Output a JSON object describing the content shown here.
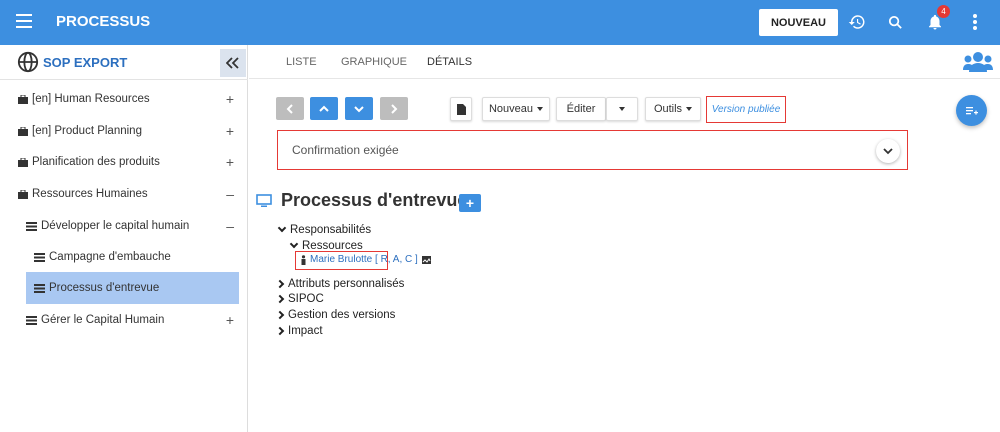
{
  "header": {
    "title": "PROCESSUS",
    "new_button": "NOUVEAU",
    "notification_count": "4",
    "accent_color": "#3d8fe0"
  },
  "sidebar": {
    "title": "SOP EXPORT",
    "items": [
      {
        "label": "[en] Human Resources",
        "toggle": "+"
      },
      {
        "label": "[en] Product Planning",
        "toggle": "+"
      },
      {
        "label": "Planification des produits",
        "toggle": "+"
      },
      {
        "label": "Ressources Humaines",
        "toggle": "–"
      },
      {
        "label": "Développer le capital humain",
        "toggle": "–"
      },
      {
        "label": "Campagne d'embauche",
        "toggle": ""
      },
      {
        "label": "Processus d'entrevue",
        "toggle": ""
      },
      {
        "label": "Gérer le Capital Humain",
        "toggle": "+"
      }
    ]
  },
  "tabs": [
    {
      "label": "LISTE"
    },
    {
      "label": "GRAPHIQUE"
    },
    {
      "label": "DÉTAILS"
    }
  ],
  "toolbar": {
    "nouveau": "Nouveau",
    "editer": "Éditer",
    "outils": "Outils",
    "version": "Version publiée"
  },
  "confirmation": {
    "text": "Confirmation exigée"
  },
  "main": {
    "title": "Processus d'entrevue",
    "add_label": "+",
    "tree": {
      "responsabilites": "Responsabilités",
      "ressources": "Ressources",
      "resource_entry": "Marie Brulotte [ R, A, C ]",
      "attributs": "Attributs personnalisés",
      "sipoc": "SIPOC",
      "versions": "Gestion des versions",
      "impact": "Impact"
    }
  }
}
